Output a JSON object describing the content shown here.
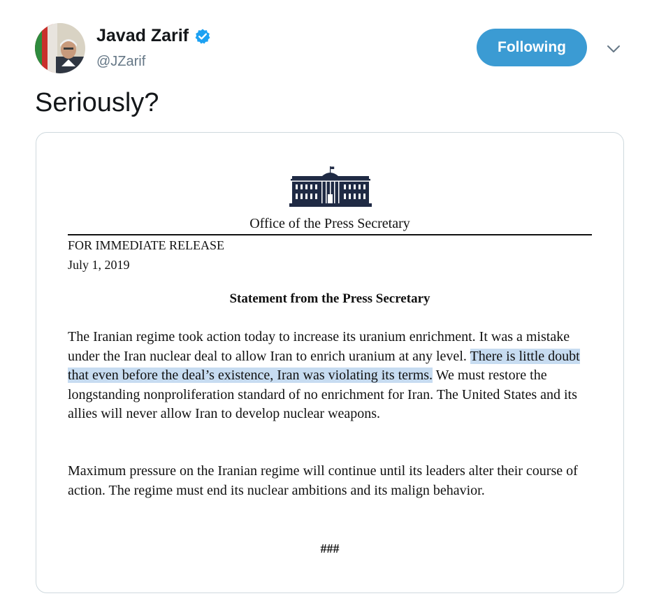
{
  "tweet": {
    "author": {
      "display_name": "Javad Zarif",
      "handle": "@JZarif",
      "verified": true
    },
    "follow_button_label": "Following",
    "text": "Seriously?",
    "media": {
      "office": "Office of the Press Secretary",
      "release": "FOR IMMEDIATE RELEASE",
      "date": "July 1, 2019",
      "heading": "Statement from the Press Secretary",
      "paragraph1": {
        "before": "The Iranian regime took action today to increase its uranium enrichment.  It was a mistake under the Iran nuclear deal to allow Iran to enrich uranium at any level. ",
        "highlight": "There is little doubt that even before the deal’s existence, Iran was violating its terms.",
        "after": "  We must restore the longstanding nonproliferation standard of no enrichment for Iran.  The United States and its allies will never allow Iran to develop nuclear weapons."
      },
      "paragraph2": "Maximum pressure on the Iranian regime will continue until its leaders alter their course of action.  The regime must end its nuclear ambitions and its malign behavior.",
      "end_mark": "###"
    }
  },
  "icons": {
    "verified": "verified-badge-icon",
    "chevron": "chevron-down-icon",
    "logo": "white-house-icon"
  },
  "colors": {
    "follow_button": "#3b9bd3",
    "verified_badge": "#1da1f2",
    "highlight": "#c7dcf1"
  }
}
